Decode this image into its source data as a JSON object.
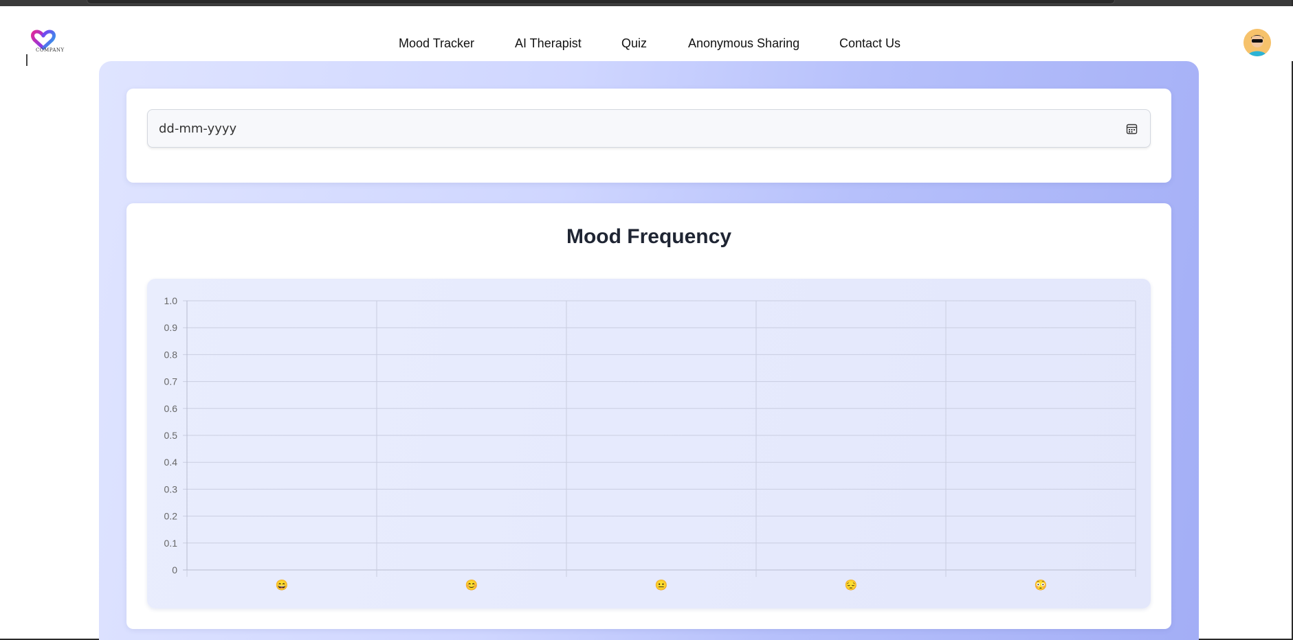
{
  "nav": {
    "items": [
      {
        "label": "Mood Tracker"
      },
      {
        "label": "AI Therapist"
      },
      {
        "label": "Quiz"
      },
      {
        "label": "Anonymous Sharing"
      },
      {
        "label": "Contact Us"
      }
    ]
  },
  "logo": {
    "text": "COMPANY"
  },
  "date_input": {
    "placeholder": "dd-mm-yyyy"
  },
  "chart_card": {
    "title": "Mood Frequency"
  },
  "chart_data": {
    "type": "bar",
    "title": "Mood Frequency",
    "categories": [
      "😄",
      "😊",
      "😐",
      "😔",
      "😳"
    ],
    "values": [
      0,
      0,
      0,
      0,
      0
    ],
    "ylim": [
      0,
      1
    ],
    "yticks": [
      "1.0",
      "0.9",
      "0.8",
      "0.7",
      "0.6",
      "0.5",
      "0.4",
      "0.3",
      "0.2",
      "0.1",
      "0"
    ],
    "grid": true,
    "xlabel": "",
    "ylabel": ""
  },
  "colors": {
    "accent": "#a3aef6",
    "grid": "#c9cde0",
    "axis_text": "#666666"
  }
}
